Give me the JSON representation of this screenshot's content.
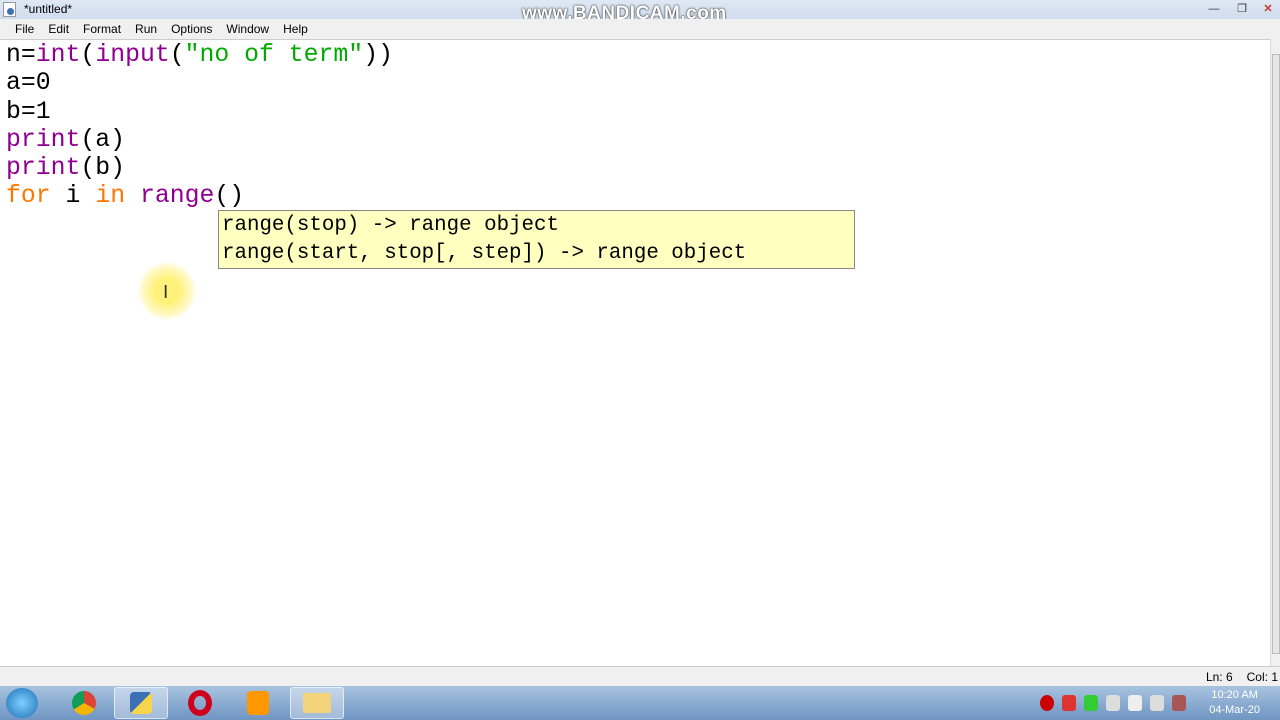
{
  "window": {
    "title": "*untitled*",
    "watermark": "www.BANDICAM.com",
    "min": "—",
    "max": "❐",
    "close": "✕"
  },
  "menu": [
    "File",
    "Edit",
    "Format",
    "Run",
    "Options",
    "Window",
    "Help"
  ],
  "code_lines": [
    [
      {
        "t": "n=",
        "c": "plain"
      },
      {
        "t": "int",
        "c": "builtin"
      },
      {
        "t": "(",
        "c": "plain"
      },
      {
        "t": "input",
        "c": "builtin"
      },
      {
        "t": "(",
        "c": "plain"
      },
      {
        "t": "\"no of term\"",
        "c": "string"
      },
      {
        "t": "))",
        "c": "plain"
      }
    ],
    [
      {
        "t": "a=0",
        "c": "plain"
      }
    ],
    [
      {
        "t": "b=1",
        "c": "plain"
      }
    ],
    [
      {
        "t": "print",
        "c": "builtin"
      },
      {
        "t": "(a)",
        "c": "plain"
      }
    ],
    [
      {
        "t": "print",
        "c": "builtin"
      },
      {
        "t": "(b)",
        "c": "plain"
      }
    ],
    [
      {
        "t": "for",
        "c": "keyword"
      },
      {
        "t": " i ",
        "c": "plain"
      },
      {
        "t": "in",
        "c": "keyword"
      },
      {
        "t": " ",
        "c": "plain"
      },
      {
        "t": "range",
        "c": "builtin"
      },
      {
        "t": "()",
        "c": "plain"
      }
    ]
  ],
  "calltip": {
    "line1": "range(stop) -> range object",
    "line2": "range(start, stop[, step]) -> range object"
  },
  "status": {
    "line": "Ln: 6",
    "col": "Col: 1"
  },
  "taskbar": {
    "apps": [
      "chrome-icon",
      "python-idle-icon",
      "opera-icon",
      "sublime-icon",
      "folder-icon"
    ]
  },
  "clock": {
    "time": "10:20 AM",
    "date": "04-Mar-20"
  },
  "colors": {
    "builtin": "#900090",
    "string": "#00aa00",
    "keyword": "#ff7700",
    "calltip_bg": "#ffffc0"
  }
}
